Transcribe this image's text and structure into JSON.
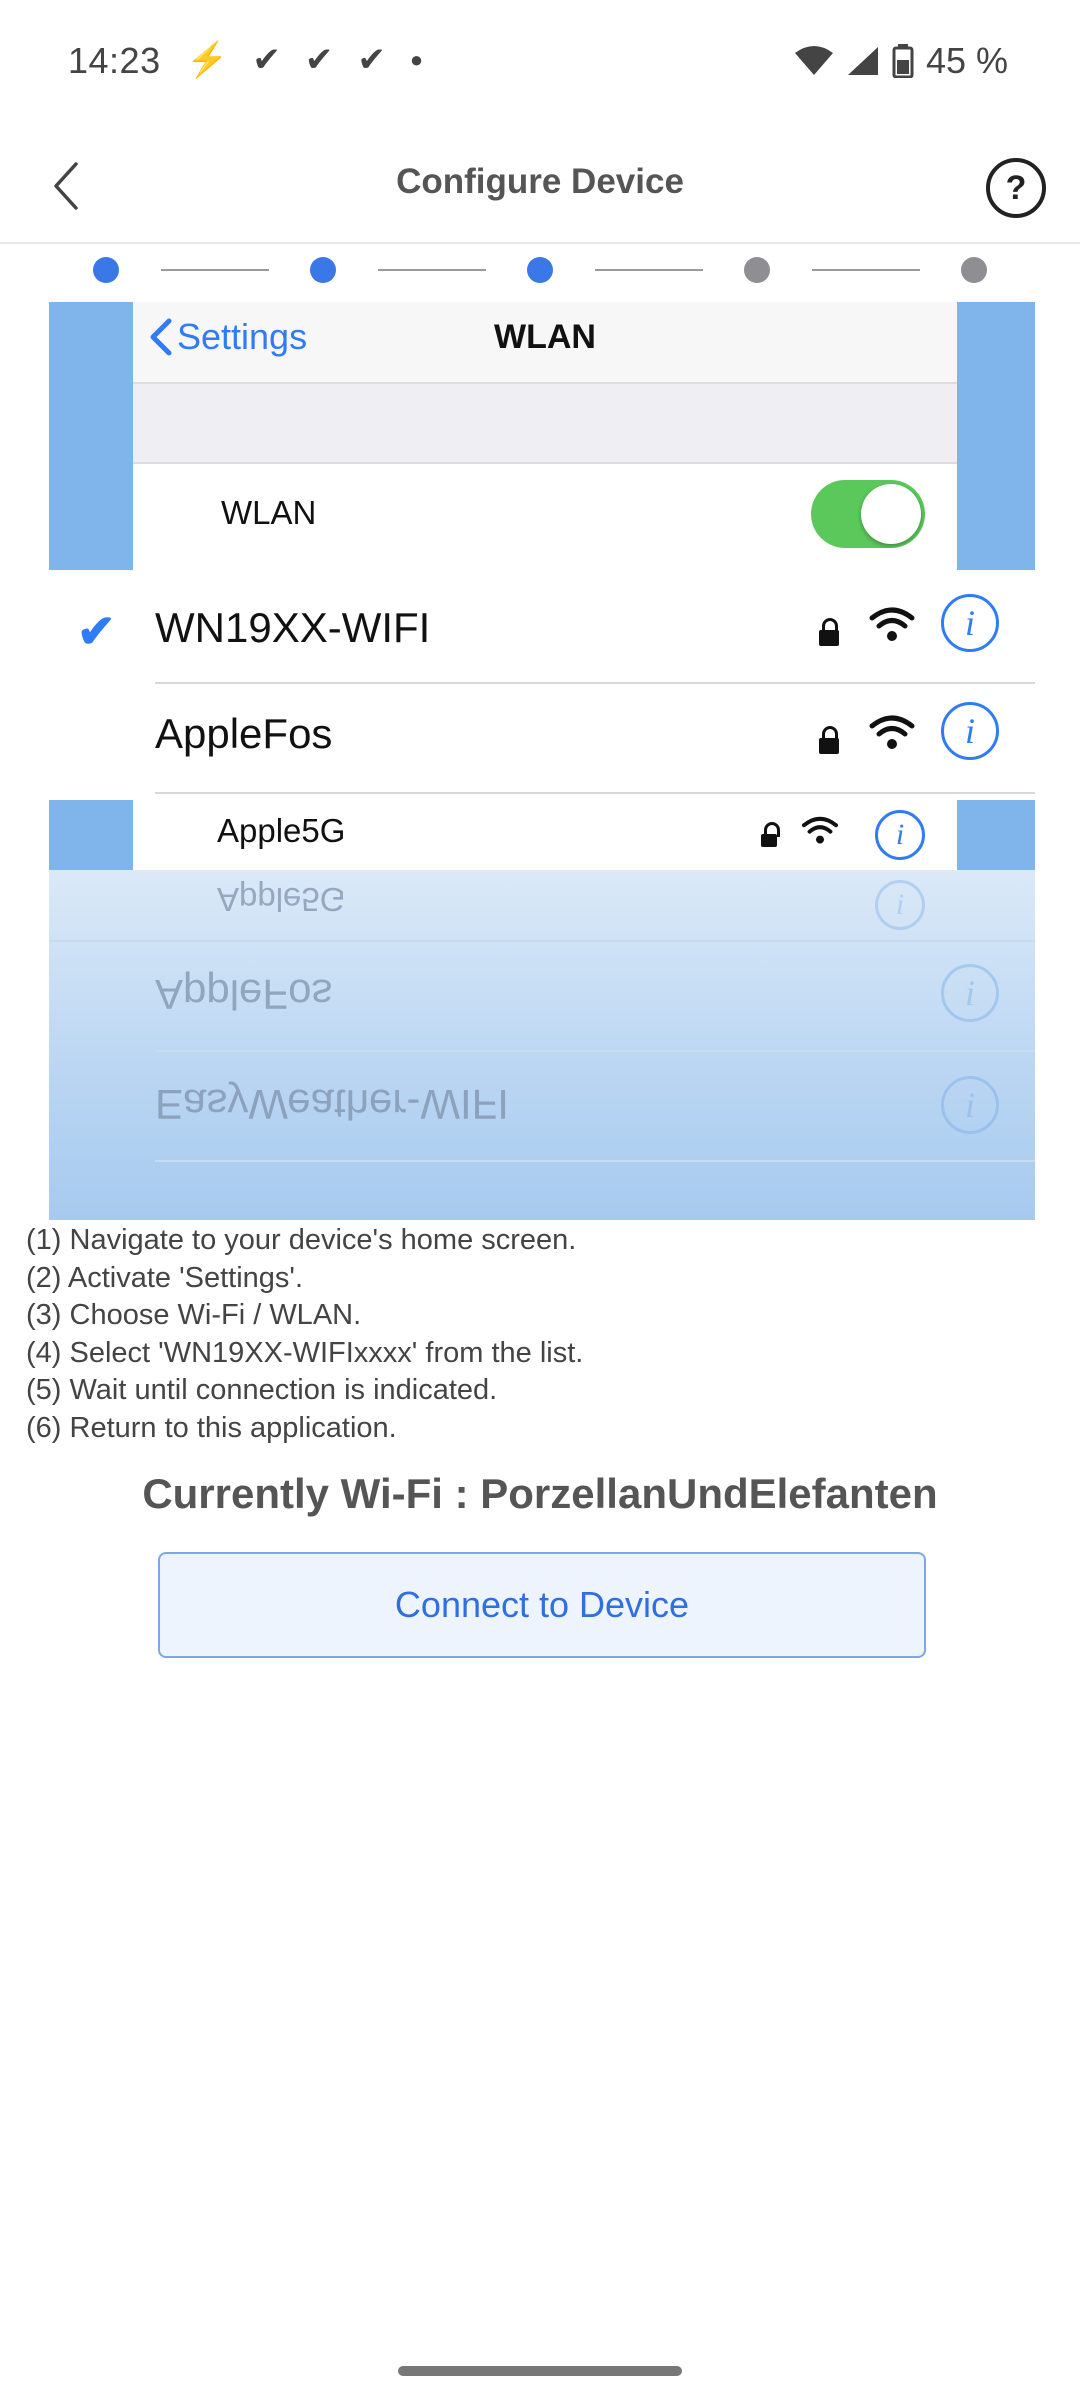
{
  "status_bar": {
    "time": "14:23",
    "battery": "45 %",
    "notification_icons": [
      "flash-icon",
      "check-icon",
      "check-icon",
      "check-icon",
      "dot-icon"
    ]
  },
  "header": {
    "title": "Configure Device",
    "help_symbol": "?"
  },
  "stepper": {
    "steps_total": 5,
    "current_step": 3,
    "active_color": "#3b78e7",
    "inactive_color": "#8e8e93"
  },
  "illustration": {
    "nav_back": "Settings",
    "nav_title": "WLAN",
    "wlan_label": "WLAN",
    "networks": [
      {
        "name": "WN19XX-WIFI",
        "selected": true
      },
      {
        "name": "AppleFos"
      },
      {
        "name": "Apple5G"
      }
    ],
    "reflected": [
      "Apple5G",
      "AppleFos",
      "EasyWeather-WIFI"
    ]
  },
  "instructions": [
    "(1) Navigate to your device's home screen.",
    "(2) Activate 'Settings'.",
    "(3) Choose Wi-Fi / WLAN.",
    "(4) Select 'WN19XX-WIFIxxxx' from the list.",
    "(5) Wait until connection is indicated.",
    "(6) Return to this application."
  ],
  "current_wifi": "Currently Wi-Fi : PorzellanUndElefanten",
  "connect_button": "Connect to Device"
}
